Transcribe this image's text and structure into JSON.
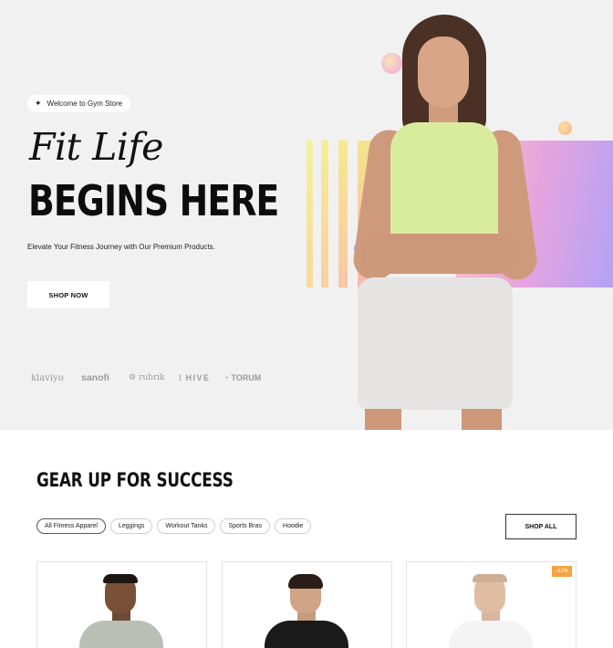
{
  "hero": {
    "welcome": "Welcome to Gym Store",
    "script_title": "Fit Life",
    "headline": "BEGINS HERE",
    "subtitle": "Elevate Your Fitness Journey with Our Premium Products.",
    "cta_label": "SHOP NOW",
    "brands": [
      "klaviyo",
      "sanofi",
      "rubrik",
      "HIVE",
      "TORUM"
    ],
    "colors": {
      "background": "#f2f1f1",
      "tank_top": "#d9ec9d",
      "gradient_panel": [
        "#f8c6bd",
        "#e6a4df",
        "#b3a2f5"
      ]
    }
  },
  "section": {
    "title": "GEAR UP FOR SUCCESS",
    "filters": [
      "All Fitness Apparel",
      "Leggings",
      "Workout Tanks",
      "Sports Bras",
      "Hoodie"
    ],
    "active_filter": "All Fitness Apparel",
    "shop_all_label": "SHOP ALL"
  },
  "products": [
    {
      "shirt_color": "#b9bfb4",
      "badge": ""
    },
    {
      "shirt_color": "#1a1a1a",
      "badge": ""
    },
    {
      "shirt_color": "#f4f4f4",
      "badge": "-31%"
    }
  ],
  "icons": {
    "welcome": "sparkle-icon",
    "rubrik_mark": "rubrik-logo-icon",
    "hive_mark": "hive-logo-icon",
    "torum_mark": "torum-logo-icon"
  },
  "accent_colors": {
    "badge": "#f4a340"
  }
}
